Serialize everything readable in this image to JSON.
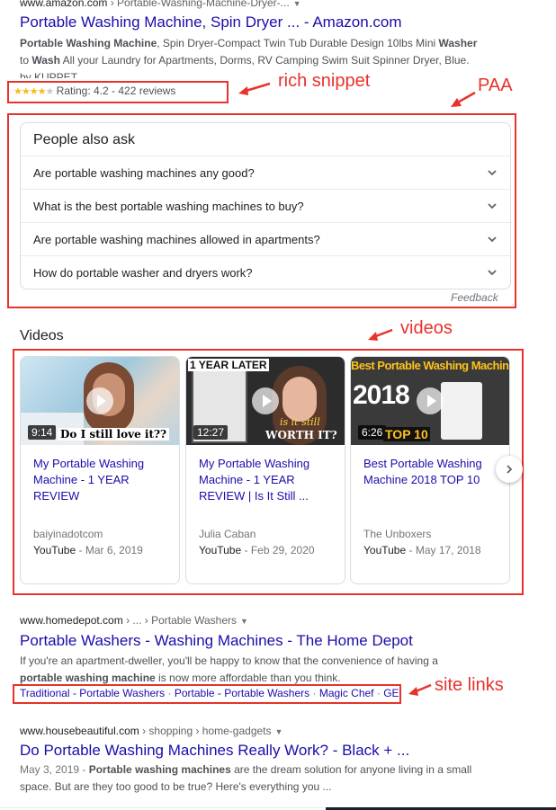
{
  "result1": {
    "url_domain": "www.amazon.com",
    "url_path": " › Portable-Washing-Machine-Dryer-...",
    "title": "Portable Washing Machine, Spin Dryer ... - Amazon.com",
    "snippet_line1_bold": "Portable Washing Machine",
    "snippet_line1_rest": ", Spin Dryer-Compact Twin Tub Durable Design 10lbs Mini ",
    "snippet_line1_bold2": "Washer",
    "snippet_line2_pre": "to ",
    "snippet_line2_bold": "Wash",
    "snippet_line2_rest": " All your Laundry for Apartments, Dorms, RV Camping Swim Suit Spinner Dryer, Blue.",
    "snippet_line3": "by KUPPET",
    "rating_text": "Rating: 4.2 - 422 reviews",
    "rating_value": 4.2,
    "stars_filled": "★★★★",
    "stars_empty": "★"
  },
  "annotations": {
    "rich_snippet": "rich snippet",
    "paa": "PAA",
    "videos": "videos",
    "site_links": "site links"
  },
  "paa": {
    "heading": "People also ask",
    "questions": [
      "Are portable washing machines any good?",
      "What is the best portable washing machines to buy?",
      "Are portable washing machines allowed in apartments?",
      "How do portable washer and dryers work?"
    ],
    "feedback": "Feedback"
  },
  "videos": {
    "heading": "Videos",
    "items": [
      {
        "duration": "9:14",
        "overlay_text": "Do I still love it??",
        "title": "My Portable Washing Machine - 1 YEAR REVIEW",
        "channel": "baiyinadotcom",
        "source": "YouTube",
        "date": " - Mar 6, 2019"
      },
      {
        "duration": "12:27",
        "overlay_text": "1 YEAR LATER",
        "overlay_text2": "is it still",
        "overlay_text3": "WORTH IT?",
        "title": "My Portable Washing Machine - 1 YEAR REVIEW | Is It Still ...",
        "channel": "Julia Caban",
        "source": "YouTube",
        "date": " - Feb 29, 2020"
      },
      {
        "duration": "6:26",
        "overlay_text": "Best Portable Washing Machine",
        "overlay_year": "2018",
        "overlay_top": "TOP 10",
        "title": "Best Portable Washing Machine 2018 TOP 10",
        "channel": "The Unboxers",
        "source": "YouTube",
        "date": " - May 17, 2018"
      }
    ]
  },
  "result2": {
    "url_domain": "www.homedepot.com",
    "url_path": " › ... › Portable Washers",
    "title": "Portable Washers - Washing Machines - The Home Depot",
    "snippet_line1": "If you're an apartment-dweller, you'll be happy to know that the convenience of having a",
    "snippet_line2_bold": "portable washing machine",
    "snippet_line2_rest": " is now more affordable than you think.",
    "sitelinks": [
      "Traditional - Portable Washers",
      "Portable - Portable Washers",
      "Magic Chef",
      "GE"
    ],
    "sitelink_sep": " · "
  },
  "result3": {
    "url_domain": "www.housebeautiful.com",
    "url_path": " › shopping › home-gadgets",
    "title": "Do Portable Washing Machines Really Work? - Black + ...",
    "snippet_date": "May 3, 2019 - ",
    "snippet_line1_bold": "Portable washing machines",
    "snippet_line1_rest": " are the dream solution for anyone living in a small",
    "snippet_line2": "space. But are they too good to be true? Here's everything you ..."
  },
  "colors": {
    "annotation_red": "#e8322b",
    "link_blue": "#1a0dab",
    "star_gold": "#f8b91a"
  }
}
